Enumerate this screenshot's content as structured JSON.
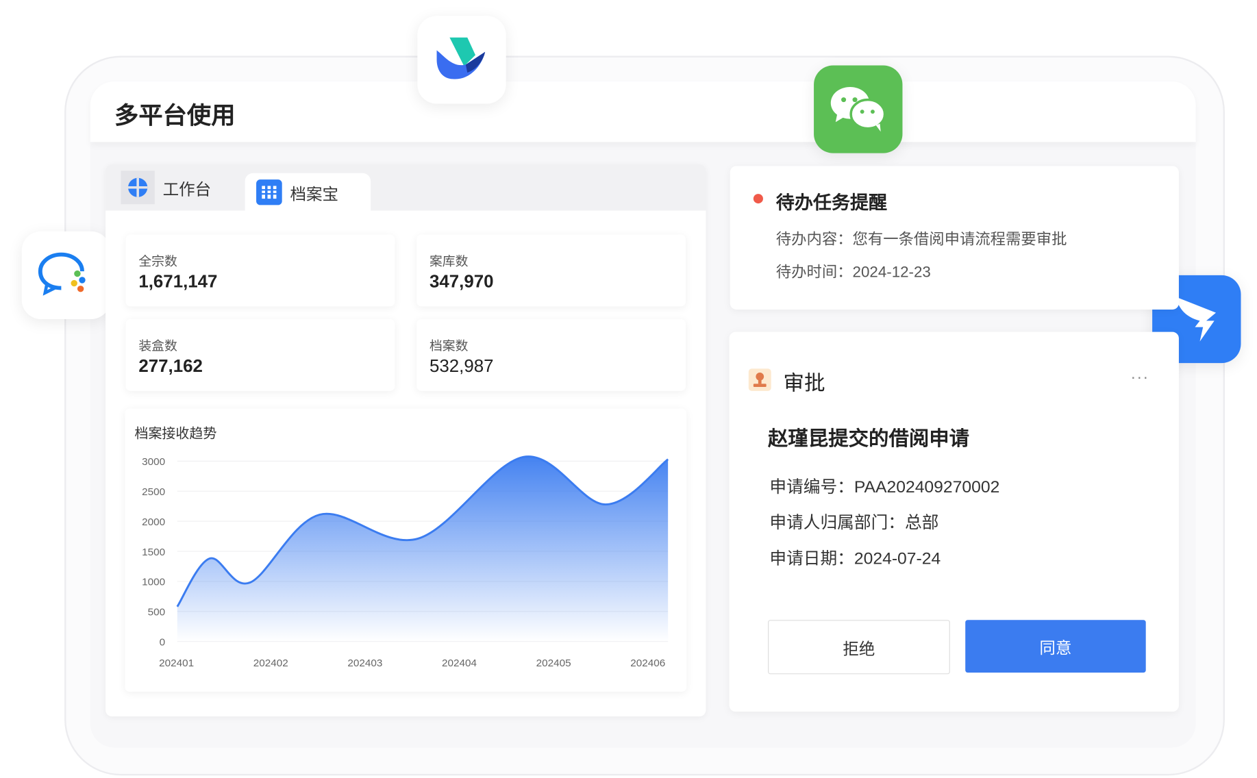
{
  "header": {
    "title": "多平台使用"
  },
  "tabs": [
    {
      "label": "工作台",
      "icon": "workbench-icon"
    },
    {
      "label": "档案宝",
      "icon": "archive-icon"
    }
  ],
  "stats": [
    {
      "label": "全宗数",
      "value": "1,671,147"
    },
    {
      "label": "案库数",
      "value": "347,970"
    },
    {
      "label": "装盒数",
      "value": "277,162"
    },
    {
      "label": "档案数",
      "value": "532,987"
    }
  ],
  "chart_data": {
    "type": "area",
    "title": "档案接收趋势",
    "categories": [
      "202401",
      "202402",
      "202403",
      "202404",
      "202405",
      "202406"
    ],
    "yticks": [
      "0",
      "500",
      "1000",
      "1500",
      "2000",
      "2500",
      "3000"
    ],
    "ylim": [
      0,
      3000
    ],
    "points": [
      [
        0,
        580
      ],
      [
        0.33,
        1380
      ],
      [
        0.74,
        980
      ],
      [
        1.45,
        2110
      ],
      [
        2.45,
        1710
      ],
      [
        3.53,
        3070
      ],
      [
        4.36,
        2280
      ],
      [
        5,
        3030
      ]
    ],
    "color": "#3b7cf0"
  },
  "todo": {
    "title": "待办任务提醒",
    "content": "待办内容：您有一条借阅申请流程需要审批",
    "time": "待办时间：2024-12-23",
    "dot_color": "#f05a4a"
  },
  "approval": {
    "title": "审批",
    "more": "···",
    "subject": "赵瑾昆提交的借阅申请",
    "fields": [
      "申请编号：PAA202409270002",
      "申请人归属部门：总部",
      "申请日期：2024-07-24"
    ],
    "reject": "拒绝",
    "approve": "同意",
    "accent": "#3b7cf0"
  }
}
